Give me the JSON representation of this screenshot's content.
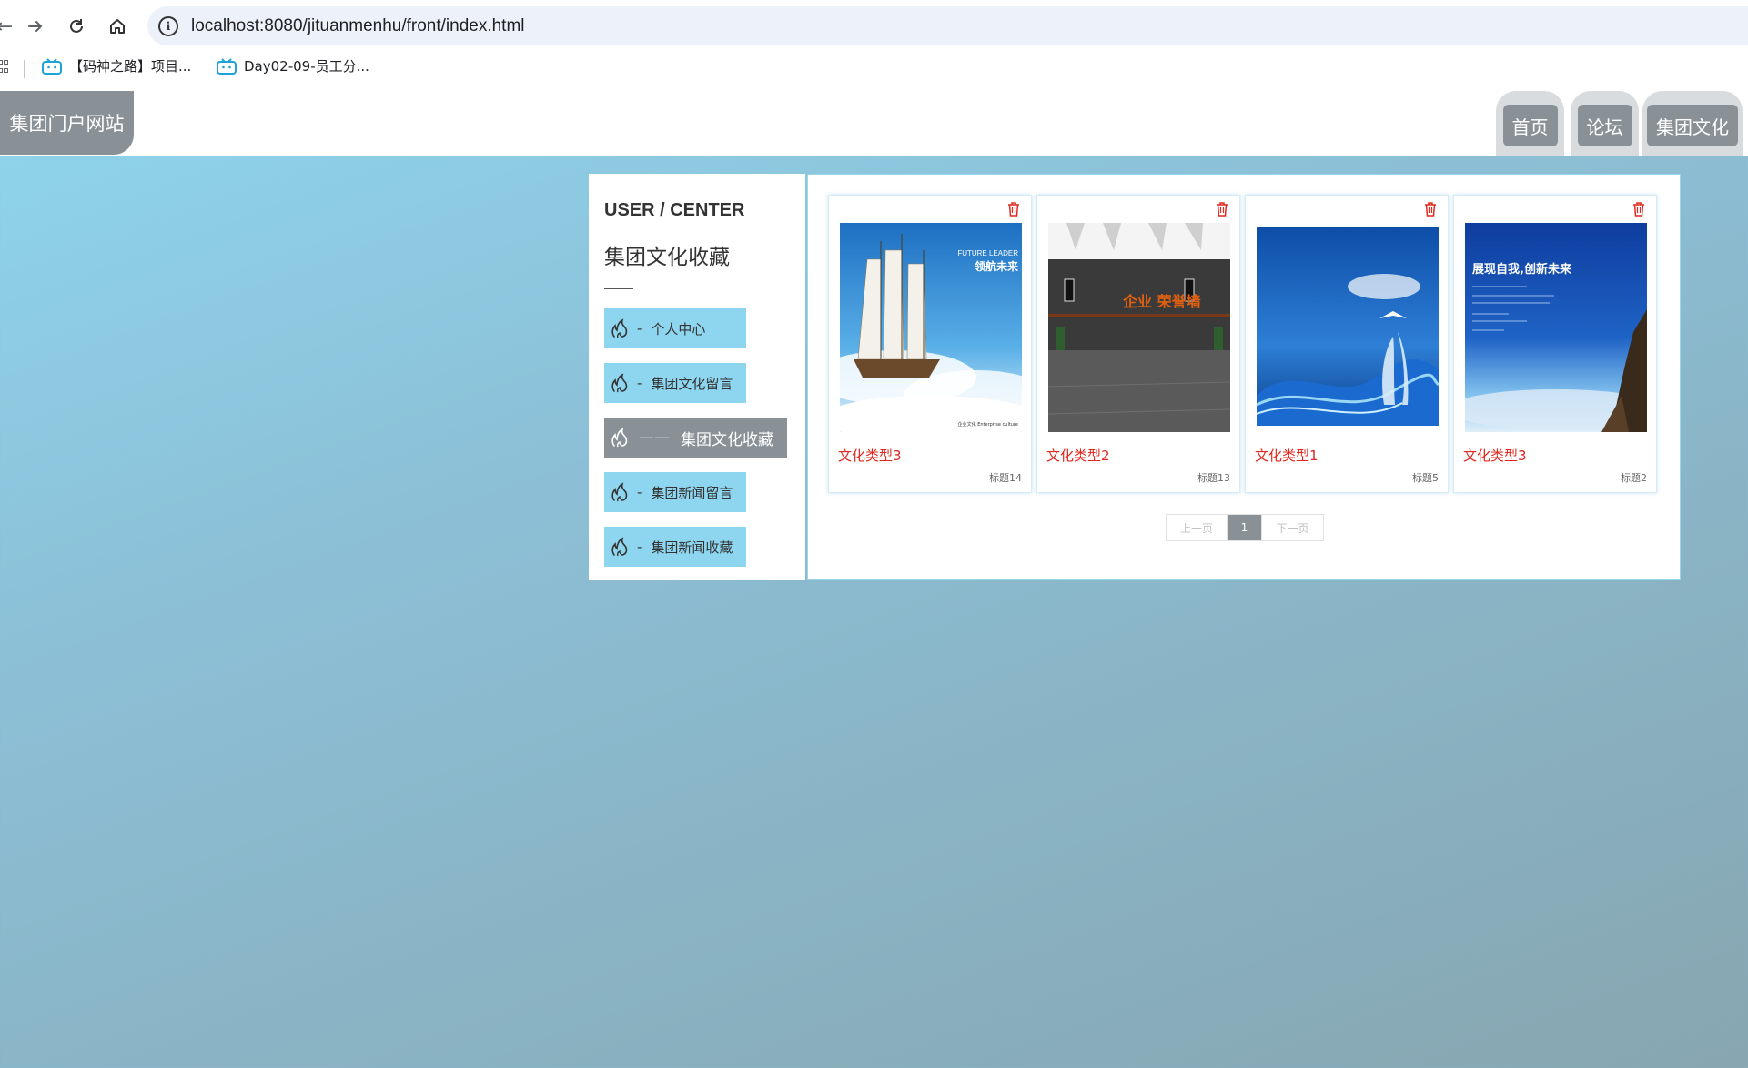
{
  "browser": {
    "url": "localhost:8080/jituanmenhu/front/index.html",
    "bookmarks": [
      {
        "label": "【码神之路】项目..."
      },
      {
        "label": "Day02-09-员工分..."
      }
    ]
  },
  "site": {
    "logo": "集团门户网站",
    "nav": [
      {
        "label": "首页"
      },
      {
        "label": "论坛"
      },
      {
        "label": "集团文化"
      }
    ]
  },
  "sidebar": {
    "title": "USER / CENTER",
    "subtitle": "集团文化收藏",
    "items": [
      {
        "dash": "-",
        "label": "个人中心",
        "active": false
      },
      {
        "dash": "-",
        "label": "集团文化留言",
        "active": false
      },
      {
        "dash": "——",
        "label": "集团文化收藏",
        "active": true
      },
      {
        "dash": "-",
        "label": "集团新闻留言",
        "active": false
      },
      {
        "dash": "-",
        "label": "集团新闻收藏",
        "active": false
      }
    ]
  },
  "cards": [
    {
      "type": "文化类型3",
      "title": "标题14",
      "image": "sailing-ship-poster",
      "poster_en": "FUTURE LEADER",
      "poster_cn": "领航未来",
      "poster_foot": "企业文化 Enterprise culture"
    },
    {
      "type": "文化类型2",
      "title": "标题13",
      "image": "honor-wall-room",
      "poster_cn": "企业 荣誉墙"
    },
    {
      "type": "文化类型1",
      "title": "标题5",
      "image": "water-hands-bird-poster"
    },
    {
      "type": "文化类型3",
      "title": "标题2",
      "image": "eagle-sky-poster",
      "poster_cn": "展现自我,创新未来"
    }
  ],
  "pagination": {
    "prev": "上一页",
    "current": "1",
    "next": "下一页"
  },
  "colors": {
    "accent_blue": "#8ed6ef",
    "active_gray": "#8a9196",
    "type_red": "#e0281e"
  }
}
